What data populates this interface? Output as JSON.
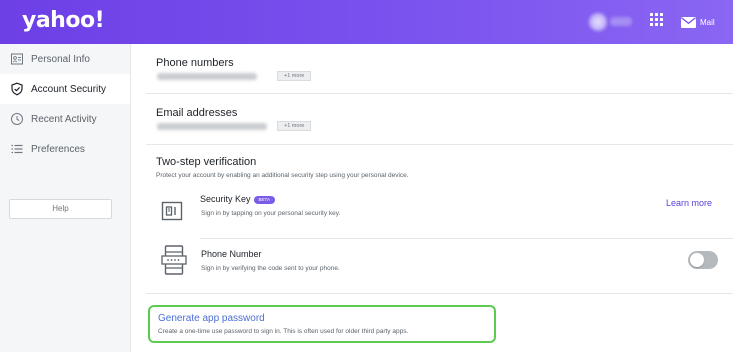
{
  "header": {
    "logo": "yahoo!",
    "mail_label": "Mail",
    "icons": [
      "apps-grid-icon",
      "mail-icon"
    ]
  },
  "sidebar": {
    "items": [
      {
        "label": "Personal Info",
        "icon": "id-card-icon",
        "active": false
      },
      {
        "label": "Account Security",
        "icon": "shield-check-icon",
        "active": true
      },
      {
        "label": "Recent Activity",
        "icon": "clock-icon",
        "active": false
      },
      {
        "label": "Preferences",
        "icon": "list-icon",
        "active": false
      }
    ],
    "help_label": "Help"
  },
  "main": {
    "phone": {
      "title": "Phone numbers",
      "more": "+1 more"
    },
    "email": {
      "title": "Email addresses",
      "more": "+1 more"
    },
    "two_step": {
      "title": "Two-step verification",
      "description": "Protect your account by enabling an additional security step using your personal device.",
      "methods": [
        {
          "title": "Security Key",
          "badge": "BETA",
          "description": "Sign in by tapping on your personal security key.",
          "action": "Learn more",
          "icon": "security-key-icon"
        },
        {
          "title": "Phone Number",
          "description": "Sign in by verifying the code sent to your phone.",
          "toggle_on": false,
          "icon": "phone-code-icon"
        }
      ]
    },
    "app_password": {
      "link": "Generate app password",
      "description": "Create a one-time use password to sign in. This is often used for older third party apps."
    }
  },
  "colors": {
    "header_start": "#6d3fe6",
    "header_end": "#8a66f3",
    "link": "#4b6fd6",
    "highlight_border": "#5ccb52",
    "beta_badge": "#7b5ce9"
  }
}
